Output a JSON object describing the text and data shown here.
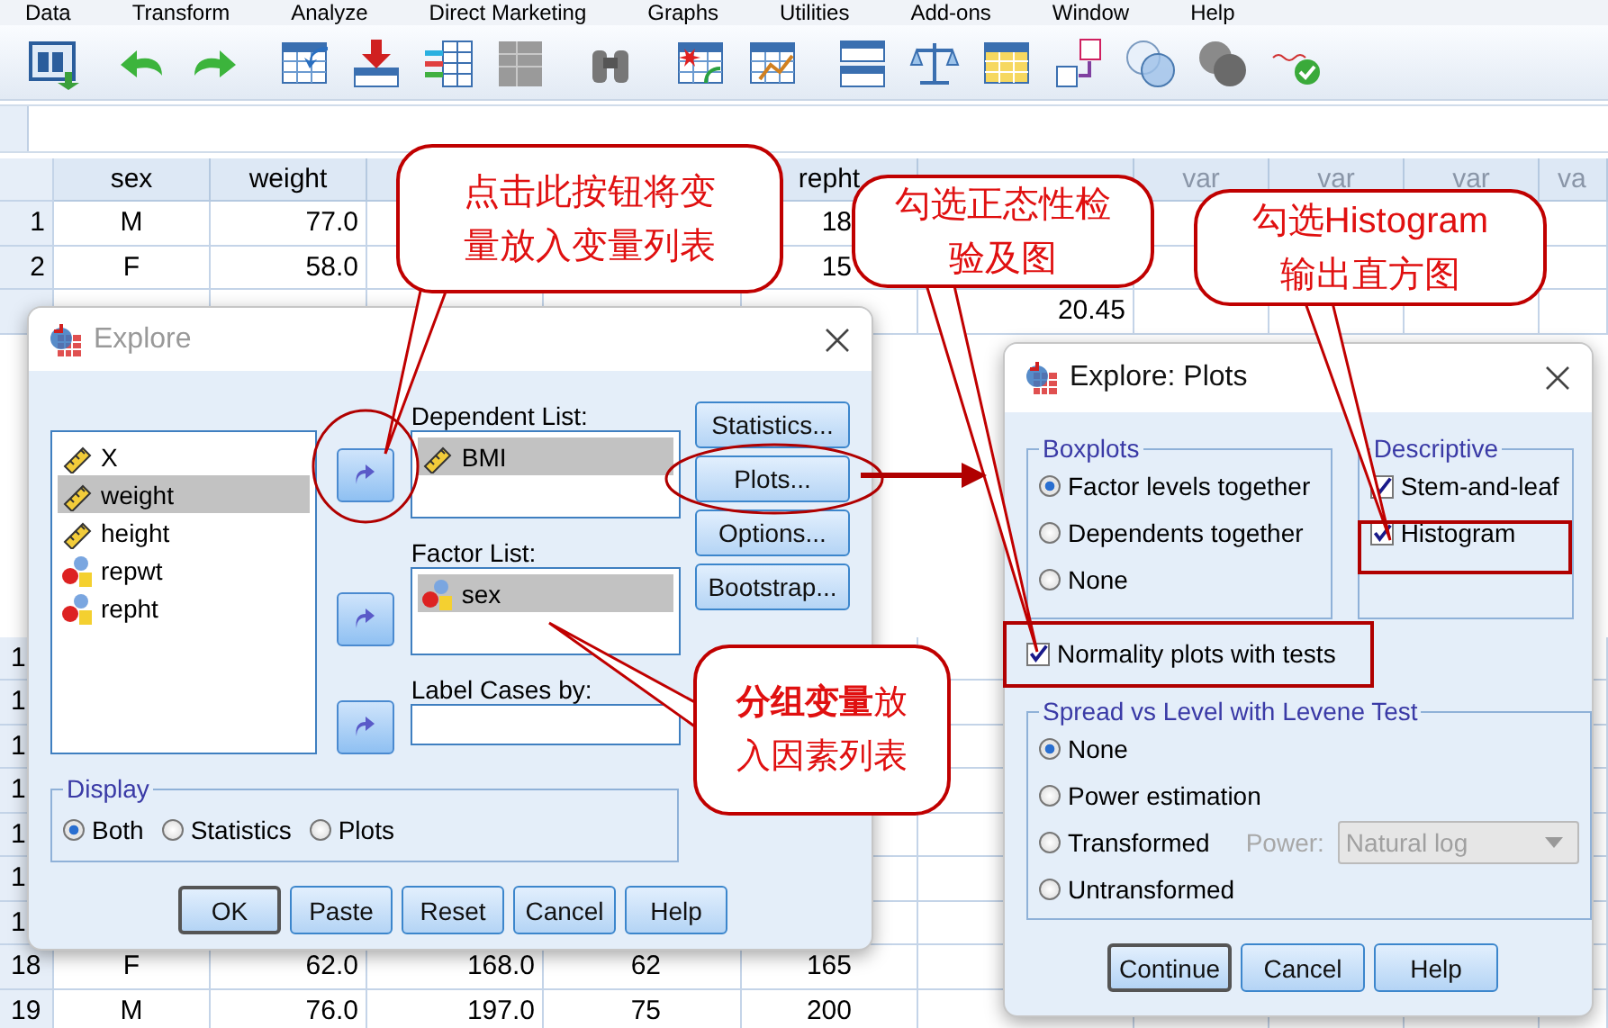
{
  "menu_bar": {
    "items": [
      "Data",
      "Transform",
      "Analyze",
      "Direct Marketing",
      "Graphs",
      "Utilities",
      "Add-ons",
      "Window",
      "Help"
    ]
  },
  "data_grid": {
    "columns": [
      "sex",
      "weight",
      null,
      null,
      "repht",
      null,
      "var",
      "var",
      "var",
      "va"
    ],
    "rows_top": [
      {
        "number": "1",
        "cells": [
          "M",
          "77.0",
          null,
          null,
          "18",
          null,
          null,
          null,
          null,
          null
        ]
      },
      {
        "number": "2",
        "cells": [
          "F",
          "58.0",
          null,
          null,
          "15",
          null,
          null,
          null,
          null,
          null
        ]
      },
      {
        "cells": [
          null,
          null,
          null,
          null,
          null,
          "20.45",
          null,
          null,
          null,
          null
        ]
      }
    ],
    "rows_bottom": [
      {
        "number": "1"
      },
      {
        "number": "1"
      },
      {
        "number": "1"
      },
      {
        "number": "1"
      },
      {
        "number": "1"
      },
      {
        "number": "1"
      },
      {
        "number": "1"
      },
      {
        "number": "18",
        "cells": [
          "F",
          "62.0",
          "168.0",
          "62",
          "165",
          null,
          null,
          null,
          null,
          null
        ]
      },
      {
        "number": "19",
        "cells": [
          "M",
          "76.0",
          "197.0",
          "75",
          "200",
          null,
          null,
          null,
          null,
          null
        ]
      }
    ]
  },
  "explore_dialog": {
    "title": "Explore",
    "source_variables": [
      {
        "name": "X",
        "kind": "scale",
        "selected": false
      },
      {
        "name": "weight",
        "kind": "scale",
        "selected": true
      },
      {
        "name": "height",
        "kind": "scale",
        "selected": false
      },
      {
        "name": "repwt",
        "kind": "nominal",
        "selected": false
      },
      {
        "name": "repht",
        "kind": "nominal",
        "selected": false
      }
    ],
    "dependent_list": {
      "label": "Dependent List:",
      "items": [
        {
          "name": "BMI",
          "kind": "scale",
          "selected": true
        }
      ]
    },
    "factor_list": {
      "label": "Factor List:",
      "items": [
        {
          "name": "sex",
          "kind": "nominal",
          "selected": true
        }
      ]
    },
    "label_cases": {
      "label": "Label Cases by:"
    },
    "side_buttons": [
      "Statistics...",
      "Plots...",
      "Options...",
      "Bootstrap..."
    ],
    "display": {
      "label": "Display",
      "options": [
        {
          "label": "Both",
          "selected": true
        },
        {
          "label": "Statistics",
          "selected": false
        },
        {
          "label": "Plots",
          "selected": false
        }
      ]
    },
    "buttons": [
      {
        "label": "OK",
        "default": true
      },
      {
        "label": "Paste",
        "default": false
      },
      {
        "label": "Reset",
        "default": false
      },
      {
        "label": "Cancel",
        "default": false
      },
      {
        "label": "Help",
        "default": false
      }
    ]
  },
  "plots_dialog": {
    "title": "Explore: Plots",
    "boxplots": {
      "label": "Boxplots",
      "options": [
        {
          "label": "Factor levels together",
          "selected": true
        },
        {
          "label": "Dependents together",
          "selected": false
        },
        {
          "label": "None",
          "selected": false
        }
      ]
    },
    "descriptive": {
      "label": "Descriptive",
      "options": [
        {
          "label": "Stem-and-leaf",
          "checked": true
        },
        {
          "label": "Histogram",
          "checked": true
        }
      ]
    },
    "normality": {
      "label": "Normality plots with tests",
      "checked": true
    },
    "spread_vs_level": {
      "label": "Spread vs Level with Levene Test",
      "options": [
        {
          "label": "None",
          "selected": true
        },
        {
          "label": "Power estimation",
          "selected": false
        },
        {
          "label": "Transformed",
          "selected": false
        },
        {
          "label": "Untransformed",
          "selected": false
        }
      ],
      "power": {
        "label": "Power:",
        "value": "Natural log",
        "disabled": true
      }
    },
    "buttons": [
      {
        "label": "Continue",
        "default": true
      },
      {
        "label": "Cancel",
        "default": false
      },
      {
        "label": "Help",
        "default": false
      }
    ]
  },
  "callouts": [
    {
      "lines": [
        "点击此按钮将变",
        "量放入变量列表"
      ]
    },
    {
      "lines": [
        "勾选正态性检",
        "验及图"
      ]
    },
    {
      "lines": [
        "勾选Histogram",
        "输出直方图"
      ]
    },
    {
      "lines": [
        "**分组变量**放",
        "入因素列表"
      ]
    }
  ]
}
